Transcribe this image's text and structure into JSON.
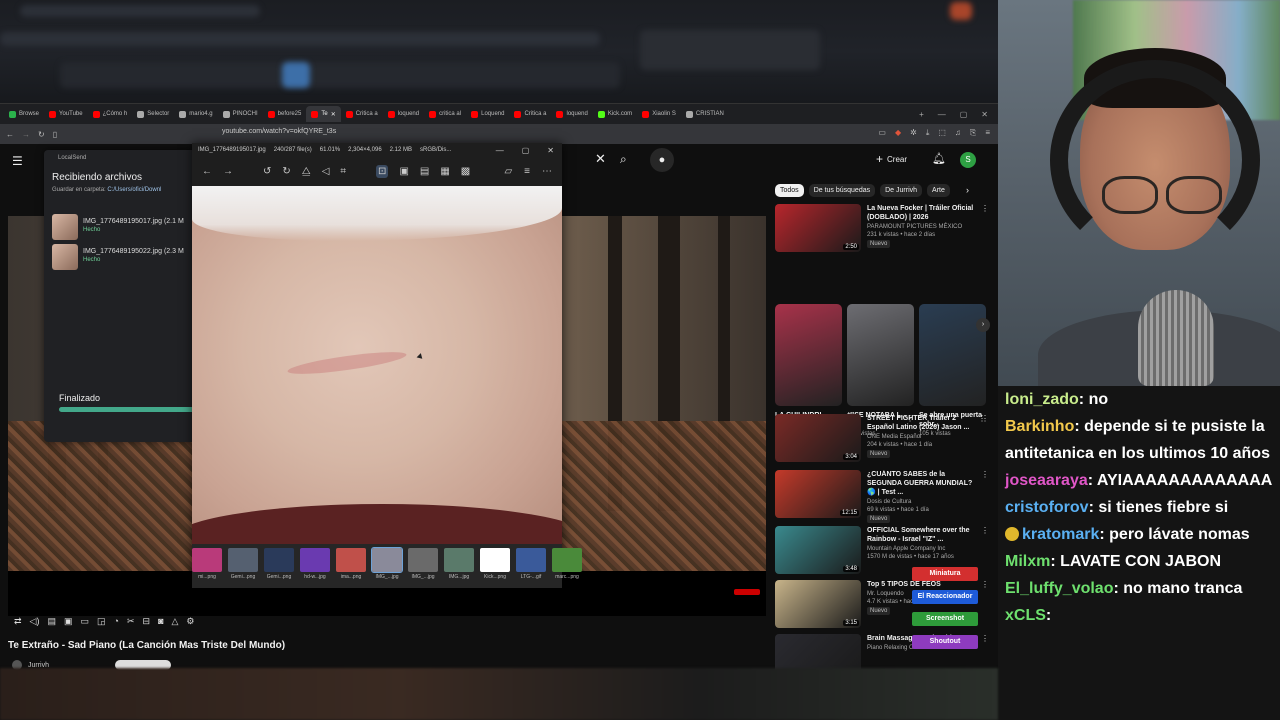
{
  "browser": {
    "tabs": [
      {
        "label": "Browse",
        "color": "#2bb24c"
      },
      {
        "label": "YouTube",
        "color": "#ff0000"
      },
      {
        "label": "¿Cómo h",
        "color": "#ff0000"
      },
      {
        "label": "Selector",
        "color": "#aaaaaa"
      },
      {
        "label": "mario4.g",
        "color": "#aaaaaa"
      },
      {
        "label": "PINOCHI",
        "color": "#aaaaaa"
      },
      {
        "label": "before25",
        "color": "#ff0000"
      },
      {
        "label": "Te",
        "color": "#ff0000",
        "active": true
      },
      {
        "label": "Critica a",
        "color": "#ff0000"
      },
      {
        "label": "loquend",
        "color": "#ff0000"
      },
      {
        "label": "critica al",
        "color": "#ff0000"
      },
      {
        "label": "Loquend",
        "color": "#ff0000"
      },
      {
        "label": "Critica a",
        "color": "#ff0000"
      },
      {
        "label": "loquend",
        "color": "#ff0000"
      },
      {
        "label": "Kick.com",
        "color": "#53fc18"
      },
      {
        "label": "Xiaolin S",
        "color": "#ff0000"
      },
      {
        "label": "CRISTIAN",
        "color": "#aaaaaa"
      }
    ],
    "url": "youtube.com/watch?v=okfQYRE_t3s"
  },
  "youtube": {
    "create_label": "Crear",
    "avatar_letter": "S",
    "video_title": "Te Extraño - Sad Piano (La Canción Mas Triste Del Mundo)",
    "channel": "Jurrivh",
    "chips": [
      "Todos",
      "De tus búsquedas",
      "De Jurrivh",
      "Arte"
    ],
    "recommendations_top": [
      {
        "title": "La Nueva Focker | Tráiler Oficial (DOBLADO) | 2026",
        "channel": "PARAMOUNT PICTURES MÉXICO",
        "stats": "231 k vistas • hace 2 días",
        "badge": "Nuevo",
        "duration": "2:50",
        "color": "#b8262c"
      }
    ],
    "shorts": [
      {
        "title": "LA CHILINDRI...",
        "views": "1 M de vistas",
        "color": "#a8324a"
      },
      {
        "title": "#\"SE NOTABA L...",
        "views": "10 k vistas",
        "color": "#6d6d72"
      },
      {
        "title": "Se abre una puerta sobr...",
        "views": "105 k vistas",
        "color": "#2a3d52"
      }
    ],
    "recommendations": [
      {
        "title": "STREET FIGHTER Tráiler 2 Español Latino (2026) Jason ...",
        "channel": "ONE Media Español",
        "stats": "204 k vistas • hace 1 día",
        "badge": "Nuevo",
        "duration": "3:04",
        "color": "#7a2a26"
      },
      {
        "title": "¿CUÁNTO SABES de la SEGUNDA GUERRA MUNDIAL? 🌎 | Test ...",
        "channel": "Dosis de Cultura",
        "stats": "69 k vistas • hace 1 día",
        "badge": "Nuevo",
        "duration": "12:15",
        "color": "#c43a2a"
      },
      {
        "title": "OFFICIAL Somewhere over the Rainbow - Israel \"IZ\" ...",
        "channel": "Mountain Apple Company Inc",
        "stats": "1570 M de vistas • hace 17 años",
        "badge": "",
        "duration": "3:48",
        "color": "#3a8a8e"
      },
      {
        "title": "Top 5 TIPOS DE FEOS",
        "channel": "Mr. Loquendo",
        "stats": "4.7 K vistas • hace 1 día",
        "badge": "Nuevo",
        "duration": "3:15",
        "color": "#c8b48a"
      },
      {
        "title": "Brain Massage Music with H...",
        "channel": "Piano Relaxing Calm",
        "stats": "",
        "badge": "",
        "duration": "",
        "color": "#2a2a30"
      }
    ]
  },
  "localsend": {
    "app": "LocalSend",
    "title": "Recibiendo archivos",
    "save_prefix": "Guardar en carpeta: ",
    "save_path": "C:/Users/ofici/Downl",
    "files": [
      {
        "name": "IMG_1776489195017.jpg (2.1 M",
        "status": "Hecho"
      },
      {
        "name": "IMG_1776489195022.jpg (2.3 M",
        "status": "Hecho"
      }
    ],
    "finished_label": "Finalizado",
    "progress": 1.0
  },
  "viewer": {
    "file": "IMG_1776489195017.jpg",
    "index": "240/287 file(s)",
    "zoom": "61.01%",
    "dimensions": "2,304×4,096",
    "size": "2.12 MB",
    "colorspace": "sRGB/Dis...",
    "thumbnails": [
      "mi...png",
      "Gemi...png",
      "Gemi...png",
      "hd-w...jpg",
      "ima...png",
      "IMG_...jpg",
      "IMG_...jpg",
      "IMG...jpg",
      "Kick...png",
      "LTG-...gif",
      "marc...png"
    ]
  },
  "overlay_buttons": [
    {
      "label": "Miniatura",
      "color": "#d32f2f"
    },
    {
      "label": "El Reaccionador",
      "color": "#1e5bd8"
    },
    {
      "label": "Screenshot",
      "color": "#2e9b3a"
    },
    {
      "label": "Shoutout",
      "color": "#8e3bbf"
    }
  ],
  "chat": [
    {
      "user": "loni_zado",
      "color": "#c8ec8c",
      "text": "no"
    },
    {
      "user": "Barkinho",
      "color": "#f2c94c",
      "text": "depende si te pusiste la antitetanica en los ultimos 10 años"
    },
    {
      "user": "joseaaraya",
      "color": "#e056c7",
      "text": "AYIAAAAAAAAAAAAA"
    },
    {
      "user": "cristoforov",
      "color": "#5ab0f2",
      "text": "si tienes fiebre si"
    },
    {
      "user": "kratomark",
      "color": "#5ab0f2",
      "text": "pero lávate nomas",
      "emoji": true
    },
    {
      "user": "Milxm",
      "color": "#6ee06e",
      "text": "LAVATE CON JABON"
    },
    {
      "user": "El_luffy_volao",
      "color": "#6ee06e",
      "text": "no mano tranca"
    },
    {
      "user": "xCLS",
      "color": "#6ee06e",
      "text": ""
    }
  ]
}
